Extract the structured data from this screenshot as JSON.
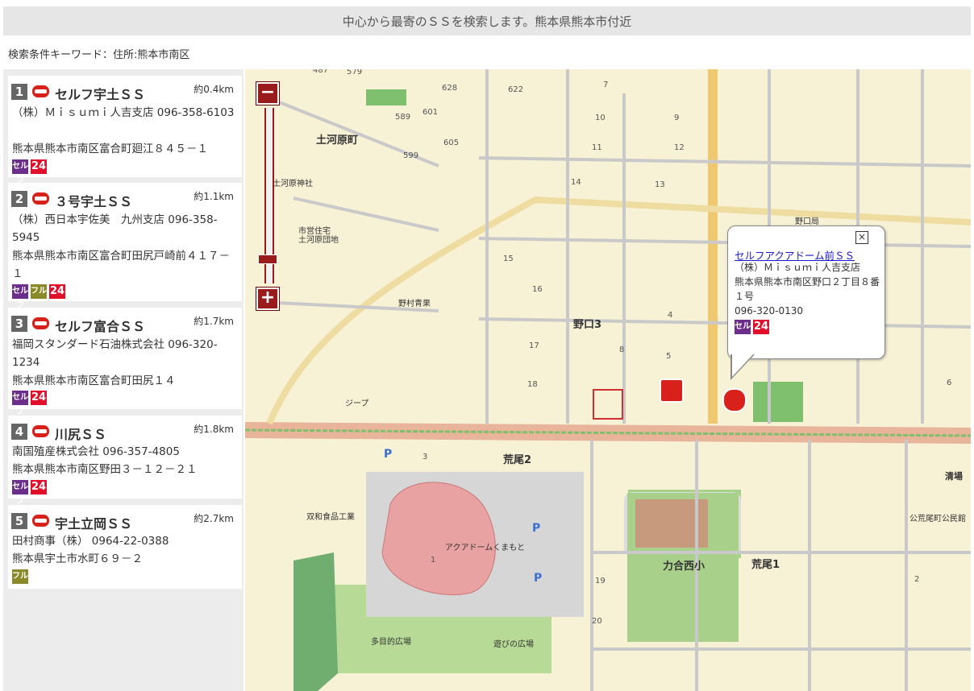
{
  "header": {
    "title": "中心から最寄のＳＳを検索します。熊本県熊本市付近"
  },
  "search": {
    "condition": "検索条件キーワード：住所:熊本市南区"
  },
  "stations": [
    {
      "rank": "1",
      "name": "セルフ宇土ＳＳ",
      "distance": "約0.4km",
      "company": "（株）Ｍｉｓｕｍｉ人吉支店 096-358-6103",
      "address": "熊本県熊本市南区富合町廻江８４５－１",
      "badges": [
        "セルフ",
        "24"
      ]
    },
    {
      "rank": "2",
      "name": "３号宇土ＳＳ",
      "distance": "約1.1km",
      "company": "（株）西日本宇佐美　九州支店 096-358-5945",
      "address": "熊本県熊本市南区富合町田尻戸崎前４１７－１",
      "badges": [
        "セルフ",
        "フル",
        "24"
      ]
    },
    {
      "rank": "3",
      "name": "セルフ富合ＳＳ",
      "distance": "約1.7km",
      "company": "福岡スタンダード石油株式会社 096-320-1234",
      "address": "熊本県熊本市南区富合町田尻１４",
      "badges": [
        "セルフ",
        "24"
      ]
    },
    {
      "rank": "4",
      "name": "川尻ＳＳ",
      "distance": "約1.8km",
      "company": "南国殖産株式会社 096-357-4805",
      "address": "熊本県熊本市南区野田３－１２－２１",
      "badges": [
        "セルフ",
        "24"
      ]
    },
    {
      "rank": "5",
      "name": "宇土立岡ＳＳ",
      "distance": "約2.7km",
      "company": "田村商事（株） 0964-22-0388",
      "address": "熊本県宇土市水町６９－２",
      "badges": [
        "フル"
      ]
    }
  ],
  "map": {
    "zoom_out": "−",
    "zoom_in": "+",
    "popup": {
      "title": "セルフアクアドーム前ＳＳ",
      "company": "（株）Ｍｉｓｕｍｉ人吉支店",
      "address": "熊本県熊本市南区野口２丁目８番１号",
      "phone": "096-320-0130",
      "close": "×",
      "badges": [
        "セルフ",
        "24"
      ]
    },
    "labels": {
      "doka": "土河原町",
      "noguchi3": "野口3",
      "arao2": "荒尾2",
      "arao1": "荒尾1",
      "rikiai": "力合西小",
      "aqua": "アクアドームくまもと",
      "tamokuteki": "多目的広場",
      "asobi": "遊びの広場",
      "sowa": "双和食品工業",
      "noguchi_post": "野口局",
      "nomura": "野村青果",
      "jeep": "ジープ",
      "kiyomi": "清場",
      "koumin": "公荒尾町公民館",
      "jutaku": "市営住宅",
      "jutaku2": "土河原団地",
      "jinja": "土河原神社",
      "n7": "7",
      "n10": "10",
      "n9": "9",
      "n11": "11",
      "n12": "12",
      "n13": "13",
      "n14": "14",
      "n15": "15",
      "n16": "16",
      "n8": "8",
      "n5": "5",
      "n4": "4",
      "n3": "3",
      "n17": "17",
      "n18": "18",
      "n19": "19",
      "n20": "20",
      "n6": "6",
      "n2": "2",
      "n1": "1",
      "n628": "628",
      "n622": "622",
      "n589": "589",
      "n601": "601",
      "n599": "599",
      "n605": "605",
      "n487": "487",
      "n579": "579"
    }
  }
}
